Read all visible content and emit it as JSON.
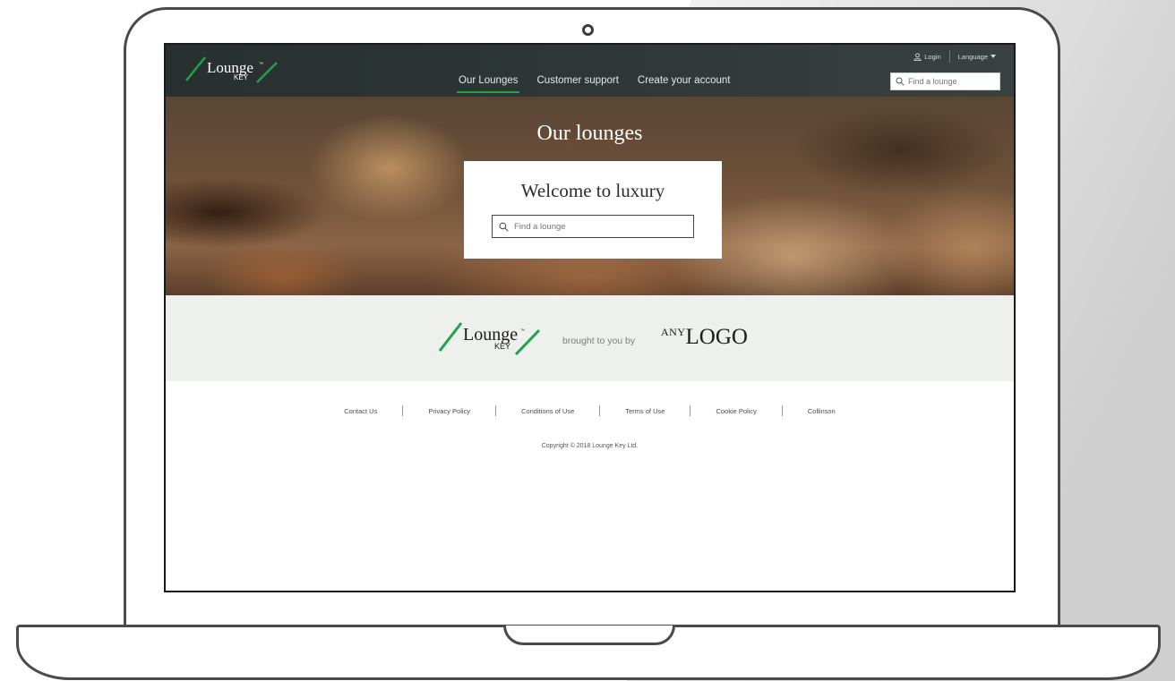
{
  "header": {
    "logo_word": "Lounge",
    "logo_tm": "™",
    "logo_sub": "KEY",
    "login_label": "Login",
    "language_label": "Language",
    "search_placeholder": "Find a lounge",
    "nav": [
      {
        "label": "Our Lounges",
        "active": true
      },
      {
        "label": "Customer support",
        "active": false
      },
      {
        "label": "Create your account",
        "active": false
      }
    ]
  },
  "hero": {
    "title": "Our lounges",
    "welcome_title": "Welcome to luxury",
    "search_placeholder": "Find a lounge"
  },
  "brand_band": {
    "logo_word": "Lounge",
    "logo_tm": "™",
    "logo_sub": "KEY",
    "brought_text": "brought to you by",
    "partner_logo_small": "ANY",
    "partner_logo_big": "LOGO"
  },
  "footer": {
    "links": [
      "Contact Us",
      "Privacy Policy",
      "Conditions of Use",
      "Terms of Use",
      "Cookie Policy",
      "Collinson"
    ],
    "copyright": "Copyright © 2018 Lounge Key Ltd."
  },
  "colors": {
    "accent_green": "#1ea34a",
    "header_bg": "#2f3837",
    "band_bg": "#eef0ee"
  }
}
